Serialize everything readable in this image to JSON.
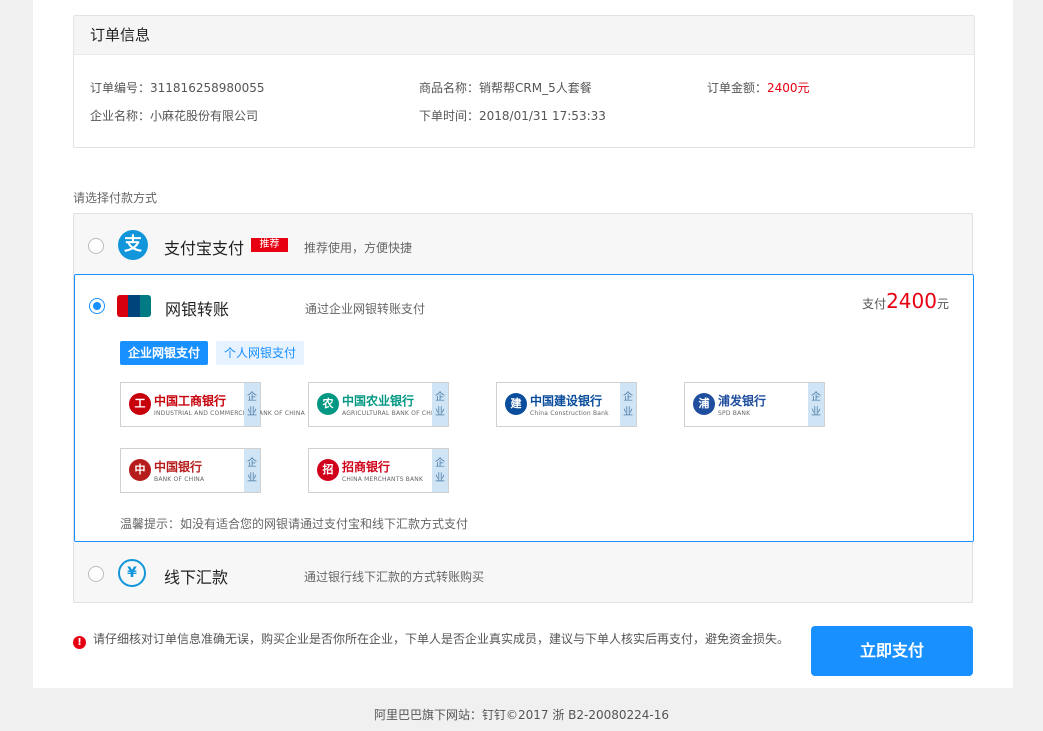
{
  "order": {
    "section_title": "订单信息",
    "number_label": "订单编号：",
    "number_value": "311816258980055",
    "product_label": "商品名称：",
    "product_value": "销帮帮CRM_5人套餐",
    "amount_label": "订单金额：",
    "amount_value": "2400元",
    "company_label": "企业名称：",
    "company_value": "小麻花股份有限公司",
    "time_label": "下单时间：",
    "time_value": "2018/01/31 17:53:33"
  },
  "payment": {
    "section_label": "请选择付款方式",
    "alipay": {
      "title": "支付宝支付",
      "icon_glyph": "支",
      "badge": "推荐",
      "desc": "推荐使用，方便快捷",
      "selected": false
    },
    "bank": {
      "title": "网银转账",
      "desc": "通过企业网银转账支付",
      "selected": true,
      "amount_prefix": "支付",
      "amount_value": "2400",
      "amount_suffix": "元",
      "tabs": [
        "企业网银支付",
        "个人网银支付"
      ],
      "active_tab": "企业网银支付",
      "banks": [
        {
          "name": "中国工商银行",
          "ename": "INDUSTRIAL AND COMMERCIAL BANK OF CHINA",
          "tag": "企业",
          "color": "#c7000b",
          "logo_glyph": "工"
        },
        {
          "name": "中国农业银行",
          "ename": "AGRICULTURAL BANK OF CHINA",
          "tag": "企业",
          "color": "#009882",
          "logo_glyph": "农"
        },
        {
          "name": "中国建设银行",
          "ename": "China Construction Bank",
          "tag": "企业",
          "color": "#0a4d9c",
          "logo_glyph": "建"
        },
        {
          "name": "浦发银行",
          "ename": "SPD BANK",
          "tag": "企业",
          "color": "#1f4e9e",
          "logo_glyph": "浦"
        },
        {
          "name": "中国银行",
          "ename": "BANK OF CHINA",
          "tag": "企业",
          "color": "#b71c1c",
          "logo_glyph": "中"
        },
        {
          "name": "招商银行",
          "ename": "CHINA MERCHANTS BANK",
          "tag": "企业",
          "color": "#d0021b",
          "logo_glyph": "招"
        }
      ],
      "tip": "温馨提示：如没有适合您的网银请通过支付宝和线下汇款方式支付"
    },
    "offline": {
      "title": "线下汇款",
      "icon_glyph": "¥",
      "desc": "通过银行线下汇款的方式转账购买",
      "selected": false
    }
  },
  "warning": {
    "icon_glyph": "!",
    "text": "请仔细核对订单信息准确无误，购买企业是否你所在企业，下单人是否企业真实成员，建议与下单人核实后再支付，避免资金损失。"
  },
  "pay_button": "立即支付",
  "footer": "阿里巴巴旗下网站：钉钉©2017 浙 B2-20080224-16",
  "colors": {
    "primary": "#1890ff",
    "price_red": "#e60012",
    "alipay_blue": "#1296db"
  }
}
